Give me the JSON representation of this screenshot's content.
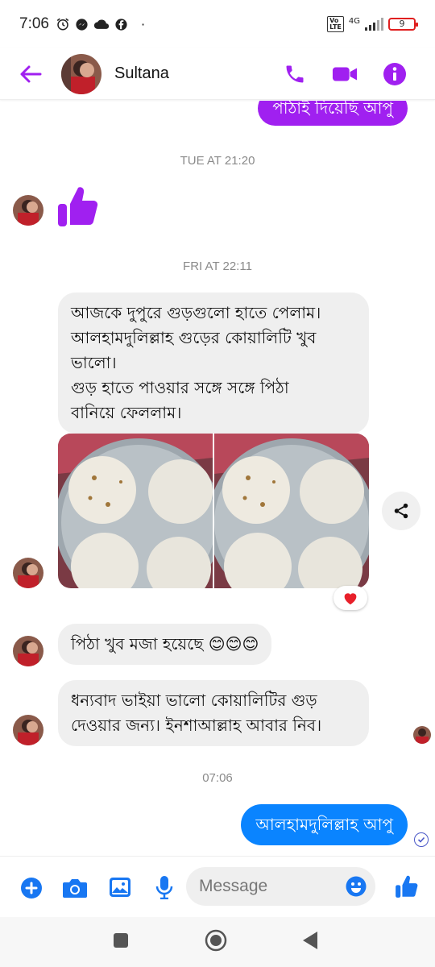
{
  "status_bar": {
    "time": "7:06",
    "network": "4G",
    "battery": "9"
  },
  "header": {
    "contact_name": "Sultana"
  },
  "messages": {
    "top_sent_partial": "পাঠাই দিয়েছি আপু",
    "ts1": "TUE AT 21:20",
    "ts2": "FRI AT 22:11",
    "received_1": [
      "আজকে দুপুরে গুড়গুলো হাতে পেলাম।",
      "আলহামদুলিল্লাহ গুড়ের কোয়ালিটি খুব",
      "ভালো।",
      "গুড় হাতে পাওয়ার সঙ্গে সঙ্গে পিঠা",
      "বানিয়ে ফেললাম।"
    ],
    "received_2": "পিঠা খুব মজা হয়েছে 😊😊😊",
    "received_3": [
      "ধন্যবাদ ভাইয়া ভালো কোয়ালিটির গুড়",
      "দেওয়ার জন্য। ইনশাআল্লাহ আবার  নিব।"
    ],
    "ts3": "07:06",
    "sent_last": "আলহামদুলিল্লাহ আপু"
  },
  "composer": {
    "placeholder": "Message"
  },
  "colors": {
    "accent_purple": "#a020f0",
    "sent_blue": "#0a84ff",
    "composer_blue": "#1877f2"
  }
}
